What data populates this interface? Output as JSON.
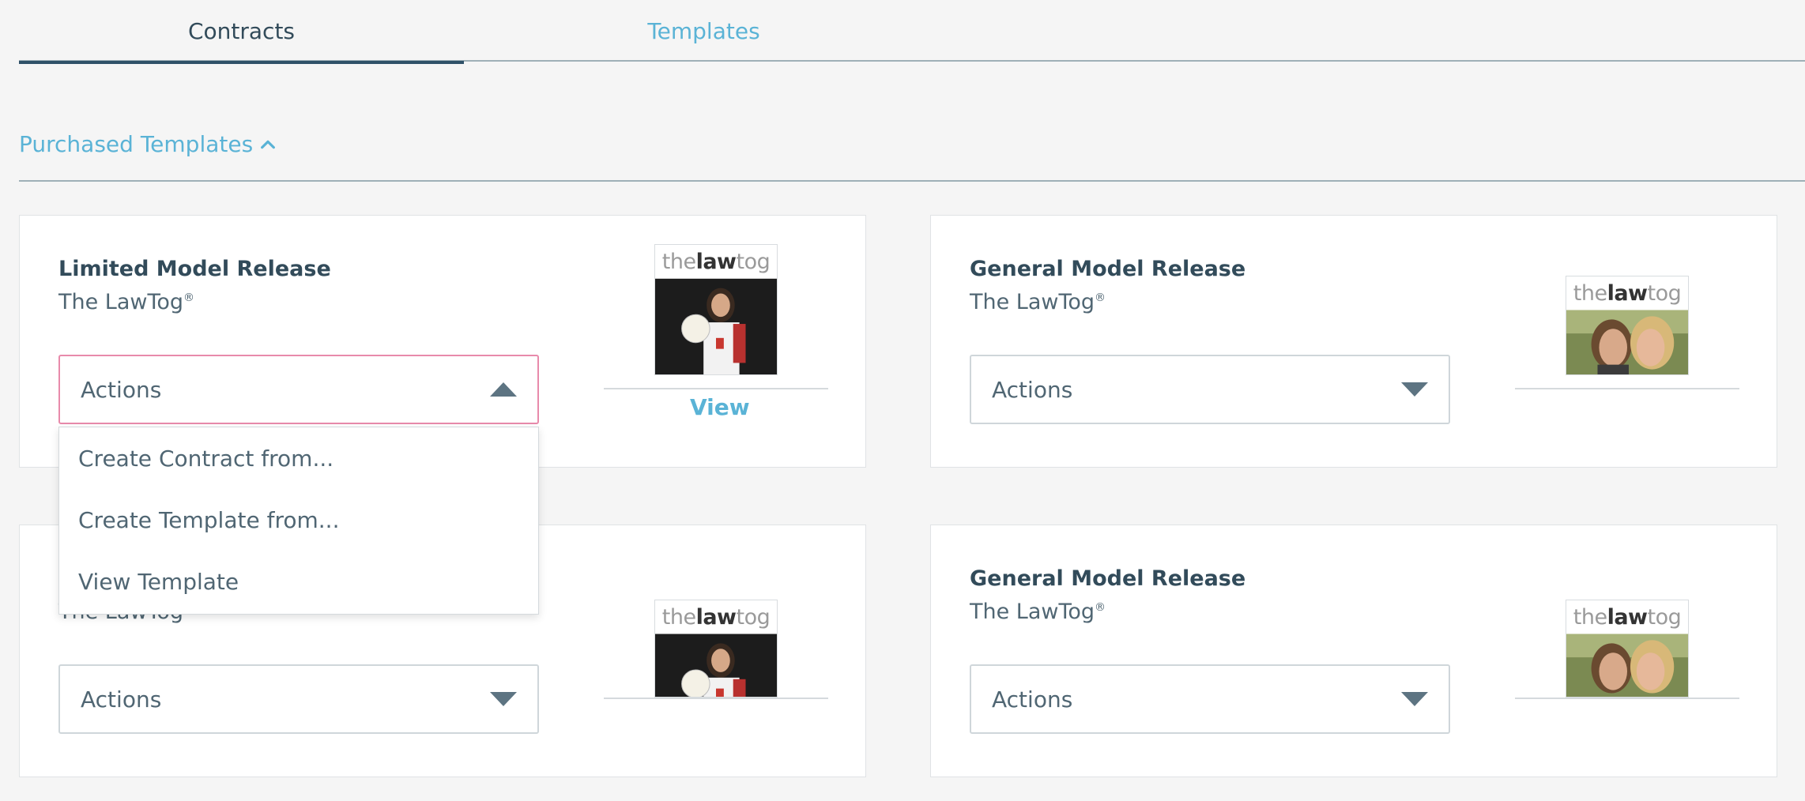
{
  "tabs": [
    {
      "label": "Contracts",
      "active": true
    },
    {
      "label": "Templates",
      "active": false
    }
  ],
  "section": {
    "title": "Purchased Templates",
    "icon": "chevron-up-icon"
  },
  "cards": [
    {
      "title": "Limited Model Release",
      "author": "The LawTog",
      "author_mark": "®",
      "actions_label": "Actions",
      "open": true,
      "view_label": "View",
      "thumb_logo_a": "the",
      "thumb_logo_b": "law",
      "thumb_logo_c": "tog"
    },
    {
      "title": "General Model Release",
      "author": "The LawTog",
      "author_mark": "®",
      "actions_label": "Actions",
      "open": false,
      "thumb_logo_a": "the",
      "thumb_logo_b": "law",
      "thumb_logo_c": "tog"
    },
    {
      "title": "",
      "author": "The LawTog",
      "author_mark": "",
      "actions_label": "Actions",
      "open": false,
      "thumb_logo_a": "the",
      "thumb_logo_b": "law",
      "thumb_logo_c": "tog"
    },
    {
      "title": "General Model Release",
      "author": "The LawTog",
      "author_mark": "®",
      "actions_label": "Actions",
      "open": false,
      "thumb_logo_a": "the",
      "thumb_logo_b": "law",
      "thumb_logo_c": "tog"
    }
  ],
  "menu": {
    "items": [
      "Create Contract from...",
      "Create Template from...",
      "View Template"
    ]
  },
  "colors": {
    "accent": "#5ab3d6",
    "text": "#324b5a",
    "open_border": "#e88aab"
  }
}
